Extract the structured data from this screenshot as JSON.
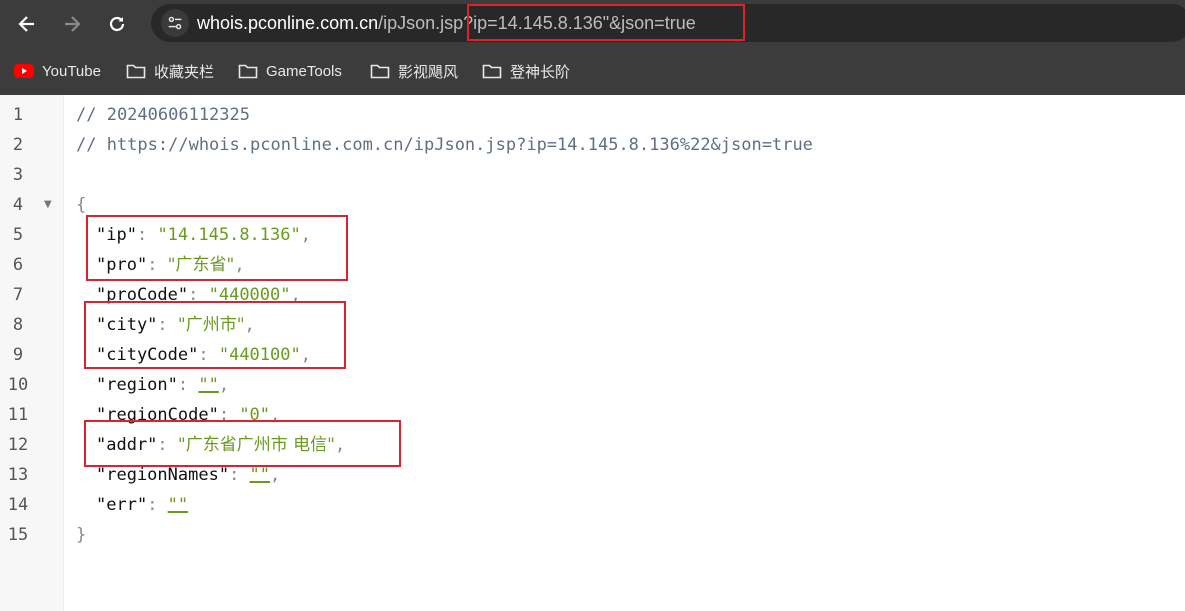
{
  "browser": {
    "url_host": "whois.pconline.com.cn",
    "url_rest": "/ipJson.jsp?ip=14.145.8.136\"&json=true"
  },
  "bookmarks": [
    {
      "label": "YouTube",
      "icon": "youtube-icon"
    },
    {
      "label": "收藏夹栏",
      "icon": "folder-icon"
    },
    {
      "label": "GameTools",
      "icon": "folder-icon"
    },
    {
      "label": "影视飓风",
      "icon": "folder-icon"
    },
    {
      "label": "登神长阶",
      "icon": "folder-icon"
    }
  ],
  "code": {
    "line_numbers": [
      "1",
      "2",
      "3",
      "4",
      "5",
      "6",
      "7",
      "8",
      "9",
      "10",
      "11",
      "12",
      "13",
      "14",
      "15"
    ],
    "comment_timestamp": "// 20240606112325",
    "comment_url": "// https://whois.pconline.com.cn/ipJson.jsp?ip=14.145.8.136%22&json=true",
    "open_brace": "{",
    "close_brace": "}",
    "fields": [
      {
        "key": "\"ip\"",
        "value": "\"14.145.8.136\""
      },
      {
        "key": "\"pro\"",
        "value": "\"广东省\""
      },
      {
        "key": "\"proCode\"",
        "value": "\"440000\""
      },
      {
        "key": "\"city\"",
        "value": "\"广州市\""
      },
      {
        "key": "\"cityCode\"",
        "value": "\"440100\""
      },
      {
        "key": "\"region\"",
        "value": "\"\""
      },
      {
        "key": "\"regionCode\"",
        "value": "\"0\""
      },
      {
        "key": "\"addr\"",
        "value": "\"广东省广州市 电信\""
      },
      {
        "key": "\"regionNames\"",
        "value": "\"\""
      },
      {
        "key": "\"err\"",
        "value": "\"\""
      }
    ]
  },
  "colors": {
    "highlight": "#d9232e",
    "string": "#6a9a1f",
    "toolbar": "#3c3c3c"
  }
}
